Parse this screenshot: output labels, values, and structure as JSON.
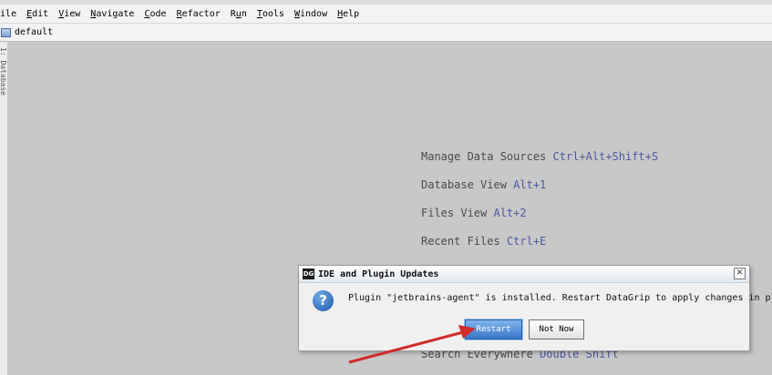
{
  "menubar": {
    "items": [
      {
        "label": "File",
        "mnemonic": "F",
        "rest": "ile"
      },
      {
        "label": "Edit",
        "mnemonic": "E",
        "rest": "dit"
      },
      {
        "label": "View",
        "mnemonic": "V",
        "rest": "iew"
      },
      {
        "label": "Navigate",
        "mnemonic": "N",
        "rest": "avigate"
      },
      {
        "label": "Code",
        "mnemonic": "C",
        "rest": "ode"
      },
      {
        "label": "Refactor",
        "mnemonic": "R",
        "rest": "efactor"
      },
      {
        "label": "Run",
        "mnemonic": "u",
        "pre": "R",
        "rest": "n"
      },
      {
        "label": "Tools",
        "mnemonic": "T",
        "rest": "ools"
      },
      {
        "label": "Window",
        "mnemonic": "W",
        "rest": "indow"
      },
      {
        "label": "Help",
        "mnemonic": "H",
        "rest": "elp"
      }
    ]
  },
  "navbar": {
    "project": "default"
  },
  "sidebar": {
    "label": "1: Database"
  },
  "hints": [
    {
      "text": "Manage Data Sources",
      "key": "Ctrl+Alt+Shift+S"
    },
    {
      "text": "Database View",
      "key": "Alt+1"
    },
    {
      "text": "Files View",
      "key": "Alt+2"
    },
    {
      "text": "Recent Files",
      "key": "Ctrl+E"
    },
    {
      "text": "Search Everywhere",
      "key": "Double Shift"
    }
  ],
  "dialog": {
    "app_icon_text": "DG",
    "title": "IDE and Plugin Updates",
    "close_glyph": "✕",
    "question_glyph": "?",
    "message": "Plugin \"jetbrains-agent\" is installed. Restart DataGrip to apply changes in plugins?",
    "buttons": {
      "restart": "Restart",
      "not_now": "Not Now"
    }
  },
  "colors": {
    "arrow": "#d22b2b",
    "shortcut_key": "#4b58a3",
    "primary_button": "#3a77c9"
  }
}
